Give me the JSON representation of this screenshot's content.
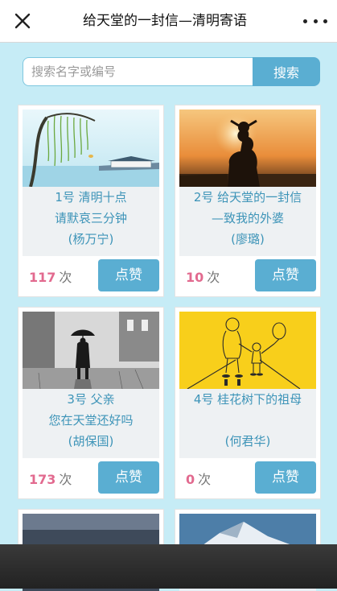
{
  "header": {
    "title": "给天堂的一封信—清明寄语",
    "close_icon": "close-icon",
    "more_icon": "more-dots-icon"
  },
  "search": {
    "placeholder": "搜索名字或编号",
    "value": "",
    "button_label": "搜索"
  },
  "count_unit": "次",
  "like_label": "点赞",
  "cards": [
    {
      "line1": "1号 清明十点",
      "line2": "请默哀三分钟",
      "line3": "(杨万宁)",
      "count": "117",
      "image": "willow-riverside-painting"
    },
    {
      "line1": "2号 给天堂的一封信",
      "line2": "—致我的外婆",
      "line3": "(廖璐)",
      "count": "10",
      "image": "sunset-silhouette-child-on-shoulders"
    },
    {
      "line1": "3号 父亲",
      "line2": "您在天堂还好吗",
      "line3": "(胡保国)",
      "count": "173",
      "image": "rainy-street-umbrella-ink"
    },
    {
      "line1": "4号 桂花树下的祖母",
      "line2": "",
      "line3": "(何君华)",
      "count": "0",
      "image": "yellow-sketch-grandmother-child"
    },
    {
      "image": "dusk-landscape"
    },
    {
      "image": "snow-mountain"
    }
  ],
  "colors": {
    "background": "#c6ecf6",
    "accent": "#5aaed2",
    "text_blue": "#3d94b8",
    "count_pink": "#e26a8f"
  }
}
